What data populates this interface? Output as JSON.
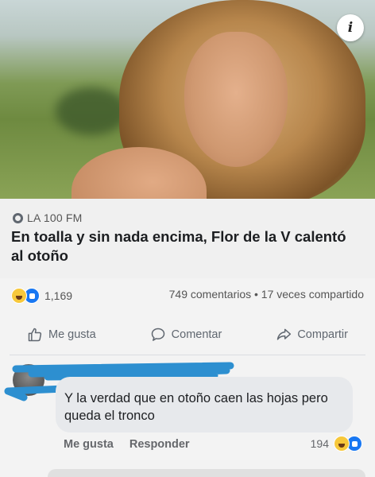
{
  "post": {
    "source": "LA 100 FM",
    "headline": "En toalla y sin nada encima, Flor de la V calentó al otoño",
    "reaction_count": "1,169",
    "stats": "749 comentarios • 17 veces compartido"
  },
  "actions": {
    "like": "Me gusta",
    "comment": "Comentar",
    "share": "Compartir"
  },
  "comment": {
    "text": "Y la verdad que en otoño caen las hojas pero queda el tronco",
    "like_label": "Me gusta",
    "reply_label": "Responder",
    "reaction_count": "194"
  },
  "icons": {
    "info": "info-icon",
    "source": "globe-icon",
    "haha": "haha-reaction-icon",
    "like": "like-reaction-icon"
  },
  "colors": {
    "facebook_blue": "#1877f2",
    "haha_yellow": "#f7c83b",
    "muted_text": "#606770"
  }
}
